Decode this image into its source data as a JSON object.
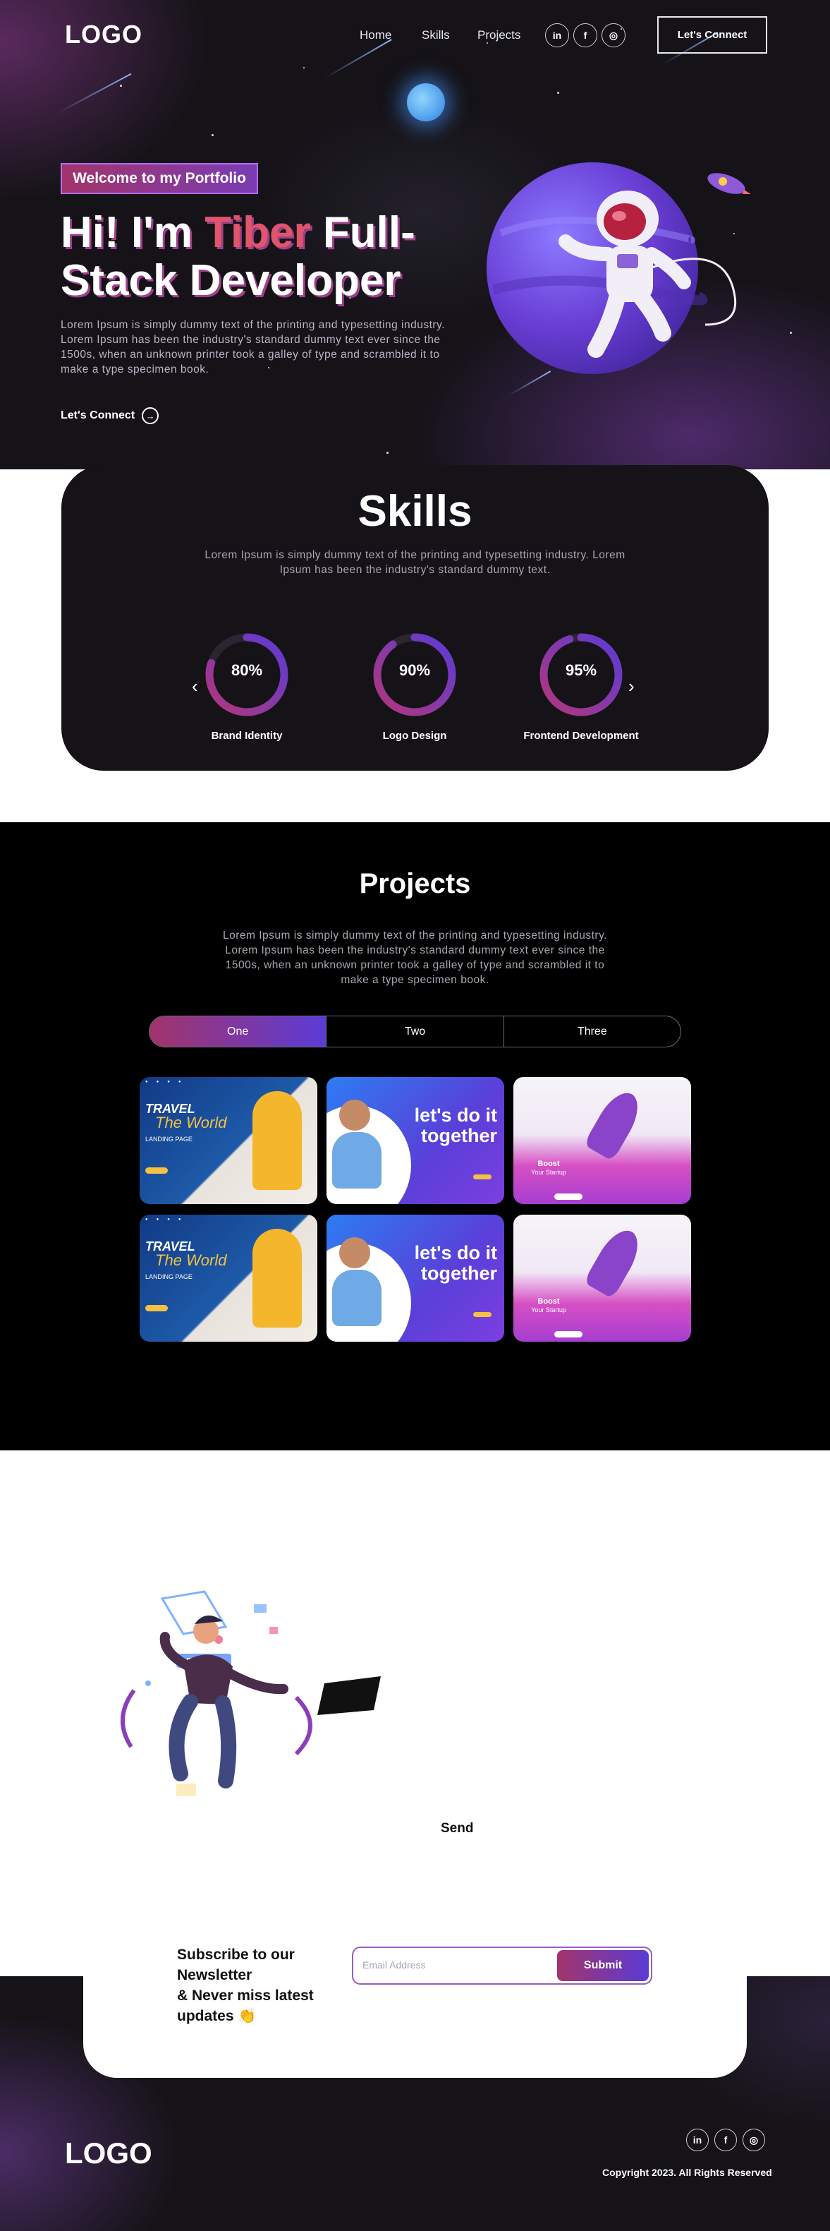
{
  "brand": {
    "logo": "LOGO"
  },
  "nav": {
    "links": [
      "Home",
      "Skills",
      "Projects"
    ],
    "social": [
      "in",
      "f",
      "◎"
    ],
    "cta": "Let's Connect"
  },
  "hero": {
    "tagline": "Welcome to my Portfolio",
    "headline_pre": "Hi! I'm ",
    "headline_highlight": "Tiber",
    "headline_post": " Full-Stack Developer",
    "body": "Lorem Ipsum is simply dummy text of the printing and typesetting industry. Lorem Ipsum has been the industry's standard dummy text ever since the 1500s, when an unknown printer took a galley of type and scrambled it to make a type specimen book.",
    "cta": "Let's Connect",
    "cta_icon": "arrow-right-circle-icon"
  },
  "skills": {
    "title": "Skills",
    "body": "Lorem Ipsum is simply dummy text of the printing and typesetting industry. Lorem Ipsum has been the industry's standard dummy text.",
    "items": [
      {
        "name": "Brand Identity",
        "percent": 80,
        "label": "80%"
      },
      {
        "name": "Logo Design",
        "percent": 90,
        "label": "90%"
      },
      {
        "name": "Frontend Development",
        "percent": 95,
        "label": "95%"
      }
    ],
    "prev": "‹",
    "next": "›"
  },
  "projects": {
    "title": "Projects",
    "body": "Lorem Ipsum is simply dummy text of the printing and typesetting industry. Lorem Ipsum has been the industry's standard dummy text ever since the 1500s, when an unknown printer took a galley of type and scrambled it to make a type specimen book.",
    "tabs": [
      "One",
      "Two",
      "Three"
    ],
    "active_tab": "One",
    "cards": [
      {
        "title": "TRAVEL",
        "subtitle": "The World",
        "caption": "LANDING PAGE"
      },
      {
        "title": "let's do it together"
      },
      {
        "title": "Boost",
        "subtitle": "Your Startup"
      },
      {
        "title": "TRAVEL",
        "subtitle": "The World",
        "caption": "LANDING PAGE"
      },
      {
        "title": "let's do it together"
      },
      {
        "title": "Boost",
        "subtitle": "Your Startup"
      }
    ]
  },
  "contact": {
    "send": "Send"
  },
  "newsletter": {
    "text_lines": [
      "Subscribe to our",
      "Newsletter",
      "& Never miss latest",
      "updates 👏"
    ],
    "placeholder": "Email Address",
    "submit": "Submit"
  },
  "footer": {
    "logo": "LOGO",
    "social": [
      "in",
      "f",
      "◎"
    ],
    "copyright": "Copyright 2023. All Rights Reserved"
  },
  "colors": {
    "accent_pink": "#a2346b",
    "accent_violet": "#5b3bd6",
    "highlight": "#e0556b"
  }
}
